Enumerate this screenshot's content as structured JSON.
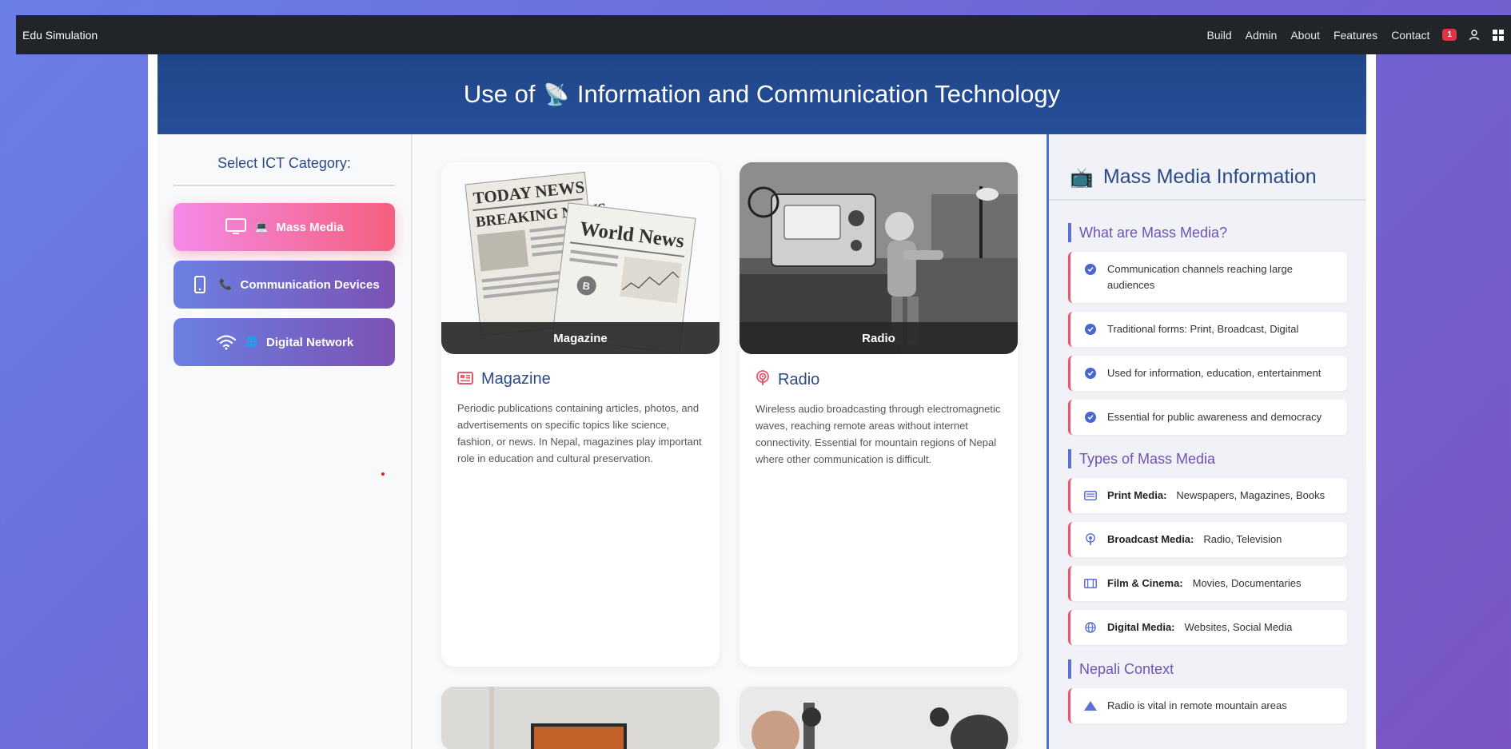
{
  "navbar": {
    "brand": "Edu Simulation",
    "links": [
      "Build",
      "Admin",
      "About",
      "Features",
      "Contact"
    ],
    "badge_count": "1"
  },
  "hero": {
    "title_prefix": "Use of",
    "title_emoji": "📡",
    "title_suffix": "Information and Communication Technology"
  },
  "sidebar": {
    "title": "Select ICT Category:",
    "categories": [
      {
        "emoji": "💻",
        "label": "Mass Media",
        "active": true
      },
      {
        "emoji": "📞",
        "label": "Communication Devices",
        "active": false
      },
      {
        "emoji": "🌐",
        "label": "Digital Network",
        "active": false
      }
    ]
  },
  "items": [
    {
      "image_caption": "Magazine",
      "title": "Magazine",
      "description": "Periodic publications containing articles, photos, and advertisements on specific topics like science, fashion, or news. In Nepal, magazines play important role in education and cultural preservation."
    },
    {
      "image_caption": "Radio",
      "title": "Radio",
      "description": "Wireless audio broadcasting through electromagnetic waves, reaching remote areas without internet connectivity. Essential for mountain regions of Nepal where other communication is difficult."
    }
  ],
  "info": {
    "emoji": "📺",
    "title": "Mass Media Information",
    "what_title": "What are Mass Media?",
    "what_items": [
      "Communication channels reaching large audiences",
      "Traditional forms: Print, Broadcast, Digital",
      "Used for information, education, entertainment",
      "Essential for public awareness and democracy"
    ],
    "types_title": "Types of Mass Media",
    "types": [
      {
        "label": "Print Media:",
        "value": "Newspapers, Magazines, Books"
      },
      {
        "label": "Broadcast Media:",
        "value": "Radio, Television"
      },
      {
        "label": "Film & Cinema:",
        "value": "Movies, Documentaries"
      },
      {
        "label": "Digital Media:",
        "value": "Websites, Social Media"
      }
    ],
    "nepali_title": "Nepali Context",
    "nepali_items": [
      "Radio is vital in remote mountain areas"
    ]
  },
  "colors": {
    "accent": "#2a4a86",
    "pink": "#f45f7e",
    "purple": "#7052b4"
  }
}
